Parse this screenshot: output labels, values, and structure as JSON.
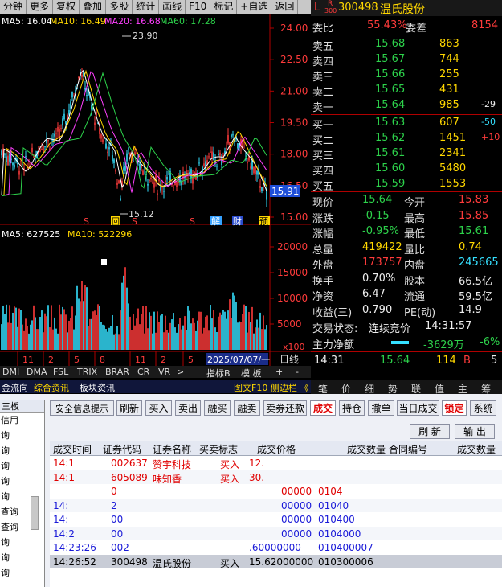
{
  "toolbar": {
    "items": [
      "分钟",
      "更多",
      "复权",
      "叠加",
      "多股",
      "统计",
      "画线",
      "F10",
      "标记",
      "+自选",
      "返回"
    ]
  },
  "price_chart": {
    "ma_labels": {
      "ma5": "MA5: 16.04",
      "ma10": "MA10: 16.49",
      "ma20": "MA20: 16.68",
      "ma60": "MA60: 17.28"
    },
    "y_ticks": [
      "24.00",
      "22.50",
      "21.00",
      "19.50",
      "18.00",
      "16.50",
      "15.00"
    ],
    "high_label": "23.90",
    "low_label": "15.12",
    "current_price": "15.91",
    "markers": [
      "S",
      "回",
      "S",
      "S",
      "解",
      "财",
      "预"
    ],
    "colors": {
      "ma5": "#ffffff",
      "ma10": "#ffd700",
      "ma20": "#ff40ff",
      "ma60": "#2dd24b",
      "up": "#ff3b3b",
      "down": "#35e0ff"
    }
  },
  "volume_chart": {
    "labels": {
      "ma5": "MA5: 627525",
      "ma10": "MA10: 522296"
    },
    "y_ticks": [
      "20000",
      "15000",
      "10000",
      "5000"
    ],
    "unit": "x100",
    "dates": [
      "11",
      "2",
      "5",
      "8",
      "11",
      "2",
      "5"
    ],
    "date_badge": "2025/07/07/一",
    "period": "日线"
  },
  "bottom_tabs": {
    "items": [
      "DMI",
      "DMA",
      "FSL",
      "TRIX",
      "BRAR",
      "CR",
      "VR",
      ">"
    ],
    "right": [
      "指标B",
      "模 板",
      "+",
      "-"
    ]
  },
  "info_tabs": {
    "items": [
      "金流向",
      "综合资讯",
      "板块资讯"
    ],
    "right": "图文F10 侧边栏 《"
  },
  "quote": {
    "code": "300498",
    "name": "温氏股份",
    "badge_top": "R",
    "badge_bottom": "300",
    "prefix": "L",
    "weibi": {
      "label": "委比",
      "value": "55.43%",
      "label2": "委差",
      "value2": "8154"
    },
    "asks": [
      {
        "label": "卖五",
        "price": "15.68",
        "vol": "863",
        "chg": ""
      },
      {
        "label": "卖四",
        "price": "15.67",
        "vol": "744",
        "chg": ""
      },
      {
        "label": "卖三",
        "price": "15.66",
        "vol": "255",
        "chg": ""
      },
      {
        "label": "卖二",
        "price": "15.65",
        "vol": "431",
        "chg": ""
      },
      {
        "label": "卖一",
        "price": "15.64",
        "vol": "985",
        "chg": "-29"
      }
    ],
    "bids": [
      {
        "label": "买一",
        "price": "15.63",
        "vol": "607",
        "chg": "-50"
      },
      {
        "label": "买二",
        "price": "15.62",
        "vol": "1451",
        "chg": "+10"
      },
      {
        "label": "买三",
        "price": "15.61",
        "vol": "2341",
        "chg": ""
      },
      {
        "label": "买四",
        "price": "15.60",
        "vol": "5480",
        "chg": ""
      },
      {
        "label": "买五",
        "price": "15.59",
        "vol": "1553",
        "chg": ""
      }
    ],
    "stats": [
      {
        "l1": "现价",
        "v1": "15.64",
        "c1": "green",
        "l2": "今开",
        "v2": "15.83",
        "c2": "red"
      },
      {
        "l1": "涨跌",
        "v1": "-0.15",
        "c1": "green",
        "l2": "最高",
        "v2": "15.85",
        "c2": "red"
      },
      {
        "l1": "涨幅",
        "v1": "-0.95%",
        "c1": "green",
        "l2": "最低",
        "v2": "15.61",
        "c2": "green"
      },
      {
        "l1": "总量",
        "v1": "419422",
        "c1": "yellow",
        "l2": "量比",
        "v2": "0.74",
        "c2": "yellow"
      },
      {
        "l1": "外盘",
        "v1": "173757",
        "c1": "red",
        "l2": "内盘",
        "v2": "245665",
        "c2": "cyan"
      },
      {
        "l1": "换手",
        "v1": "0.70%",
        "c1": "white",
        "l2": "股本",
        "v2": "66.5亿",
        "c2": "white"
      },
      {
        "l1": "净资",
        "v1": "6.47",
        "c1": "white",
        "l2": "流通",
        "v2": "59.5亿",
        "c2": "white"
      },
      {
        "l1": "收益(三)",
        "v1": "0.790",
        "c1": "white",
        "l2": "PE(动)",
        "v2": "14.9",
        "c2": "white"
      }
    ],
    "trade_status": {
      "label": "交易状态:",
      "value": "连续竞价",
      "time": "14:31:57"
    },
    "net_flow": {
      "label": "主力净额",
      "value": "-3629万",
      "pct": "-6%"
    },
    "tick": {
      "time": "14:31",
      "price": "15.64",
      "vol": "114",
      "side": "B",
      "num": "5"
    },
    "tabs": [
      "笔",
      "价",
      "细",
      "势",
      "联",
      "值",
      "主",
      "筹"
    ]
  },
  "trade_panel": {
    "left_nav": {
      "header": "三板",
      "items": [
        "信用",
        "询",
        "询",
        "询",
        "询",
        "询",
        "查询",
        "查询",
        "询",
        "询",
        "询"
      ]
    },
    "buttons": [
      "安全信息提示",
      "刷新",
      "买入",
      "卖出",
      "融买",
      "融卖",
      "卖券还款",
      "成交",
      "持仓",
      "撤单",
      "当日成交",
      "锁定",
      "系统"
    ],
    "sub_buttons": [
      "刷 新",
      "输 出"
    ],
    "headers": [
      "成交时间",
      "证券代码",
      "证券名称",
      "买卖标志",
      "成交价格",
      "成交数量",
      "合同编号",
      "成交数量"
    ],
    "rows": [
      {
        "time": "14:1",
        "code": "002637",
        "name": "赞宇科技",
        "side": "买入",
        "price": "12.",
        "amount": "",
        "contract": "",
        "color": "red"
      },
      {
        "time": "14:1",
        "code": "605089",
        "name": "味知香",
        "side": "买入",
        "price": "30.",
        "amount": "",
        "contract": "",
        "color": "red"
      },
      {
        "time": "",
        "code": "0",
        "name": "",
        "side": "",
        "price": "",
        "amount": "00000",
        "contract": "0104",
        "color": "red"
      },
      {
        "time": "14:",
        "code": "2",
        "name": "",
        "side": "",
        "price": "",
        "amount": "00000",
        "contract": "01040",
        "color": "blue"
      },
      {
        "time": "14:",
        "code": "00",
        "name": "",
        "side": "",
        "price": "",
        "amount": "00000",
        "contract": "010400",
        "color": "blue"
      },
      {
        "time": "14:2",
        "code": "00",
        "name": "",
        "side": "",
        "price": "",
        "amount": "00000",
        "contract": "0104000",
        "color": "blue"
      },
      {
        "time": "14:23:26",
        "code": "002",
        "name": "",
        "side": "",
        "price": ".60000000",
        "amount": "",
        "contract": "010400007",
        "color": "blue"
      },
      {
        "time": "14:26:52",
        "code": "300498",
        "name": "温氏股份",
        "side": "买入",
        "price": "15.62000000",
        "amount": "",
        "contract": "010300006",
        "color": "black"
      }
    ]
  }
}
